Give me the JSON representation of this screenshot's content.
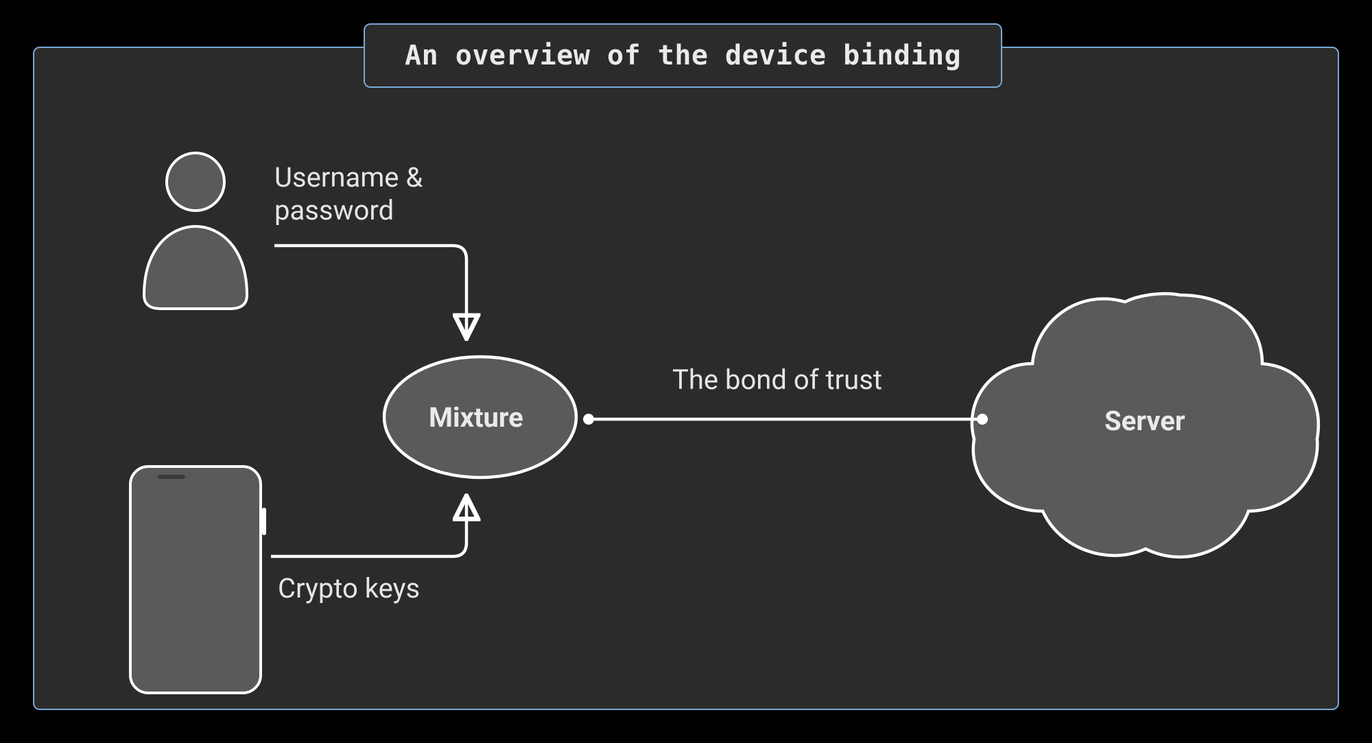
{
  "title": "An overview of the device binding",
  "labels": {
    "credentials": "Username &\npassword",
    "crypto": "Crypto keys",
    "bond": "The bond of trust"
  },
  "nodes": {
    "mixture": "Mixture",
    "server": "Server"
  },
  "colors": {
    "panel_bg": "#2b2b2b",
    "panel_border": "#7aa8d6",
    "shape_fill": "#5a5a5a",
    "shape_stroke": "#ffffff",
    "text": "#e6e6e6"
  }
}
